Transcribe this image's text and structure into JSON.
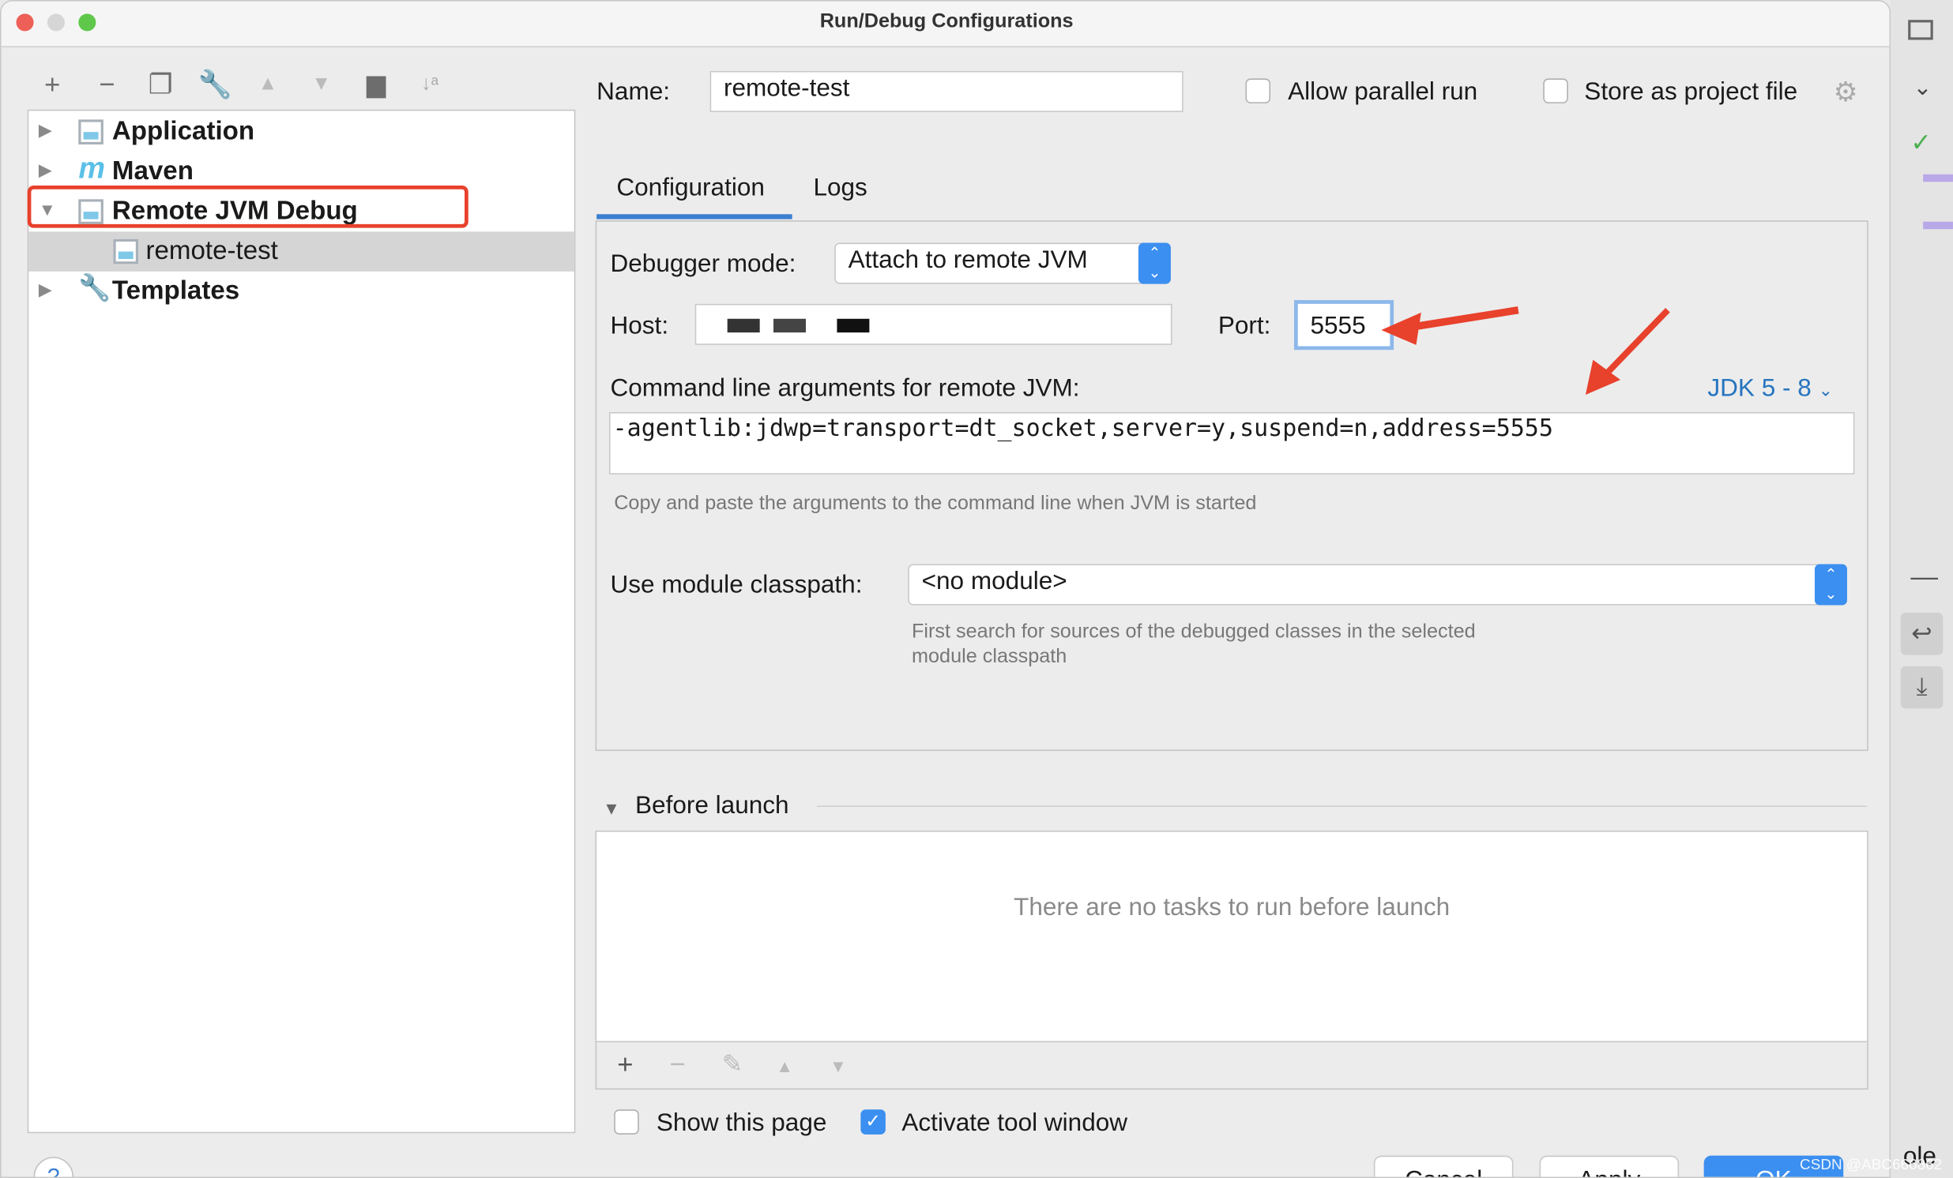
{
  "window": {
    "title": "Run/Debug Configurations"
  },
  "toolbar": {
    "icons": [
      "plus-icon",
      "minus-icon",
      "copy-icon",
      "wrench-icon",
      "arrow-up-icon",
      "arrow-down-icon",
      "folder-add-icon",
      "sort-az-icon"
    ]
  },
  "tree": {
    "items": [
      {
        "label": "Application",
        "expanded": false
      },
      {
        "label": "Maven",
        "expanded": false
      },
      {
        "label": "Remote JVM Debug",
        "expanded": true,
        "highlighted": true
      },
      {
        "label": "remote-test",
        "selected": true
      },
      {
        "label": "Templates",
        "expanded": false
      }
    ]
  },
  "name": {
    "label": "Name:",
    "value": "remote-test"
  },
  "allow_parallel": {
    "label": "Allow parallel run",
    "checked": false
  },
  "store_project": {
    "label": "Store as project file",
    "checked": false
  },
  "tabs": [
    {
      "label": "Configuration",
      "active": true
    },
    {
      "label": "Logs",
      "active": false
    }
  ],
  "config": {
    "debugger_mode_label": "Debugger mode:",
    "debugger_mode_value": "Attach to remote JVM",
    "host_label": "Host:",
    "port_label": "Port:",
    "port_value": "5555",
    "cmd_label": "Command line arguments for remote JVM:",
    "jdk_select": "JDK 5 - 8",
    "cmd_value": "-agentlib:jdwp=transport=dt_socket,server=y,suspend=n,address=5555",
    "cmd_hint": "Copy and paste the arguments to the command line when JVM is started",
    "module_label": "Use module classpath:",
    "module_value": "<no module>",
    "module_hint_1": "First search for sources of the debugged classes in the selected",
    "module_hint_2": "module classpath"
  },
  "before_launch": {
    "title": "Before launch",
    "empty": "There are no tasks to run before launch"
  },
  "show_page": {
    "label": "Show this page",
    "checked": false
  },
  "activate_tool": {
    "label": "Activate tool window",
    "checked": true
  },
  "buttons": {
    "help": "?",
    "cancel": "Cancel",
    "apply": "Apply",
    "ok": "OK"
  },
  "watermark": "CSDN @ABC666862",
  "side_fragment": "ole",
  "colors": {
    "accent": "#3b8ff0",
    "highlight": "#e8412c",
    "link": "#2675bf"
  }
}
